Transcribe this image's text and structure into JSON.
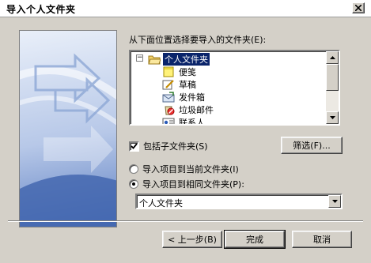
{
  "window": {
    "title": "导入个人文件夹"
  },
  "prompt": "从下面位置选择要导入的文件夹(E):",
  "tree": {
    "items": [
      {
        "label": "个人文件夹",
        "icon": "personal-folders-icon",
        "selected": true
      },
      {
        "label": "便笺",
        "icon": "notes-icon"
      },
      {
        "label": "草稿",
        "icon": "drafts-icon"
      },
      {
        "label": "发件箱",
        "icon": "outbox-icon"
      },
      {
        "label": "垃圾邮件",
        "icon": "junk-mail-icon"
      },
      {
        "label": "联系人",
        "icon": "contacts-icon"
      }
    ]
  },
  "include_subfolders": {
    "label": "包括子文件夹(S)",
    "checked": true
  },
  "filter_button": "筛选(F)...",
  "radio_current": {
    "label": "导入项目到当前文件夹(I)",
    "selected": false
  },
  "radio_same": {
    "label": "导入项目到相同文件夹(P):",
    "selected": true
  },
  "target_folder": {
    "value": "个人文件夹"
  },
  "buttons": {
    "back": "< 上一步(B)",
    "finish": "完成",
    "cancel": "取消"
  },
  "colors": {
    "selection": "#0a246a",
    "dialog": "#d4d0c8"
  }
}
